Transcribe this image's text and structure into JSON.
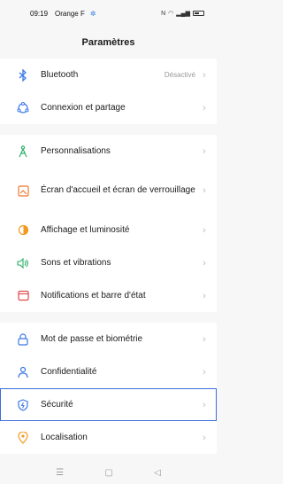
{
  "status": {
    "time": "09:19",
    "carrier": "Orange F",
    "indicators": "N"
  },
  "header": {
    "title": "Paramètres"
  },
  "groups": [
    {
      "items": [
        {
          "label": "Bluetooth",
          "value": "Désactivé",
          "icon": "bluetooth-icon"
        },
        {
          "label": "Connexion et partage",
          "icon": "connection-sharing-icon"
        }
      ]
    },
    {
      "items": [
        {
          "label": "Personnalisations",
          "icon": "personalization-icon"
        },
        {
          "label": "Écran d'accueil et écran de verrouillage",
          "icon": "home-lock-screen-icon"
        },
        {
          "label": "Affichage et luminosité",
          "icon": "display-brightness-icon"
        },
        {
          "label": "Sons et vibrations",
          "icon": "sound-icon"
        },
        {
          "label": "Notifications et barre d'état",
          "icon": "notifications-icon"
        }
      ]
    },
    {
      "items": [
        {
          "label": "Mot de passe et biométrie",
          "icon": "password-biometrics-icon"
        },
        {
          "label": "Confidentialité",
          "icon": "privacy-icon"
        },
        {
          "label": "Sécurité",
          "icon": "security-icon",
          "selected": true
        },
        {
          "label": "Localisation",
          "icon": "location-icon"
        }
      ]
    }
  ],
  "colors": {
    "accent": "#3a6fd8",
    "chevron": "#bbbbbb",
    "secondary_text": "#999999"
  }
}
